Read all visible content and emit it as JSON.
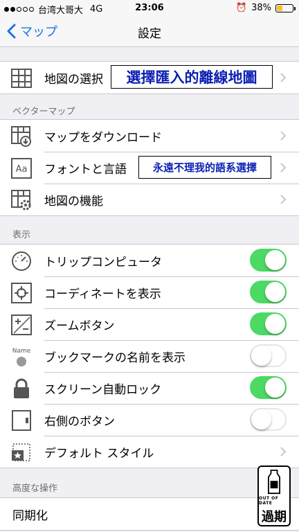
{
  "status_bar": {
    "carrier": "台湾大哥大",
    "network": "4G",
    "time": "23:06",
    "battery_percent": "38%",
    "battery_level": 0.38
  },
  "nav": {
    "back_label": "マップ",
    "title": "設定"
  },
  "group1": {
    "map_select_label": "地図の選択",
    "map_select_annotation": "選擇匯入的離線地圖"
  },
  "sections": {
    "vector_map": "ベクターマップ",
    "display": "表示",
    "advanced": "高度な操作"
  },
  "vector_map_rows": {
    "download": "マップをダウンロード",
    "font_language": "フォントと言語",
    "font_language_annotation": "永遠不理我的語系選擇",
    "map_functions": "地図の機能"
  },
  "display_rows": {
    "trip_computer": "トリップコンピュータ",
    "trip_computer_on": true,
    "coordinates": "コーディネートを表示",
    "coordinates_on": true,
    "zoom_buttons": "ズームボタン",
    "zoom_buttons_on": true,
    "bookmark_names_icon_text": "Name",
    "bookmark_names": "ブックマークの名前を表示",
    "bookmark_names_on": false,
    "screen_lock": "スクリーン自動ロック",
    "screen_lock_on": true,
    "right_button": "右側のボタン",
    "right_button_on": false,
    "default_style": "デフォルト スタイル"
  },
  "advanced_rows": {
    "sync": "同期化"
  },
  "stamp": {
    "top_text": "OUT OF DATE",
    "main_text": "過期"
  },
  "colors": {
    "ios_blue": "#1a73e8",
    "toggle_green": "#4cd964",
    "annotation_blue": "#0b1fb3"
  }
}
